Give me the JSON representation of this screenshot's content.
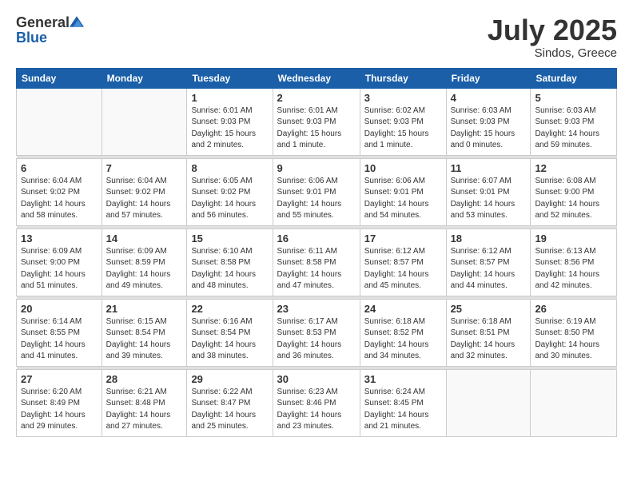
{
  "header": {
    "logo_general": "General",
    "logo_blue": "Blue",
    "title": "July 2025",
    "location": "Sindos, Greece"
  },
  "weekdays": [
    "Sunday",
    "Monday",
    "Tuesday",
    "Wednesday",
    "Thursday",
    "Friday",
    "Saturday"
  ],
  "weeks": [
    [
      {
        "day": "",
        "info": ""
      },
      {
        "day": "",
        "info": ""
      },
      {
        "day": "1",
        "info": "Sunrise: 6:01 AM\nSunset: 9:03 PM\nDaylight: 15 hours\nand 2 minutes."
      },
      {
        "day": "2",
        "info": "Sunrise: 6:01 AM\nSunset: 9:03 PM\nDaylight: 15 hours\nand 1 minute."
      },
      {
        "day": "3",
        "info": "Sunrise: 6:02 AM\nSunset: 9:03 PM\nDaylight: 15 hours\nand 1 minute."
      },
      {
        "day": "4",
        "info": "Sunrise: 6:03 AM\nSunset: 9:03 PM\nDaylight: 15 hours\nand 0 minutes."
      },
      {
        "day": "5",
        "info": "Sunrise: 6:03 AM\nSunset: 9:03 PM\nDaylight: 14 hours\nand 59 minutes."
      }
    ],
    [
      {
        "day": "6",
        "info": "Sunrise: 6:04 AM\nSunset: 9:02 PM\nDaylight: 14 hours\nand 58 minutes."
      },
      {
        "day": "7",
        "info": "Sunrise: 6:04 AM\nSunset: 9:02 PM\nDaylight: 14 hours\nand 57 minutes."
      },
      {
        "day": "8",
        "info": "Sunrise: 6:05 AM\nSunset: 9:02 PM\nDaylight: 14 hours\nand 56 minutes."
      },
      {
        "day": "9",
        "info": "Sunrise: 6:06 AM\nSunset: 9:01 PM\nDaylight: 14 hours\nand 55 minutes."
      },
      {
        "day": "10",
        "info": "Sunrise: 6:06 AM\nSunset: 9:01 PM\nDaylight: 14 hours\nand 54 minutes."
      },
      {
        "day": "11",
        "info": "Sunrise: 6:07 AM\nSunset: 9:01 PM\nDaylight: 14 hours\nand 53 minutes."
      },
      {
        "day": "12",
        "info": "Sunrise: 6:08 AM\nSunset: 9:00 PM\nDaylight: 14 hours\nand 52 minutes."
      }
    ],
    [
      {
        "day": "13",
        "info": "Sunrise: 6:09 AM\nSunset: 9:00 PM\nDaylight: 14 hours\nand 51 minutes."
      },
      {
        "day": "14",
        "info": "Sunrise: 6:09 AM\nSunset: 8:59 PM\nDaylight: 14 hours\nand 49 minutes."
      },
      {
        "day": "15",
        "info": "Sunrise: 6:10 AM\nSunset: 8:58 PM\nDaylight: 14 hours\nand 48 minutes."
      },
      {
        "day": "16",
        "info": "Sunrise: 6:11 AM\nSunset: 8:58 PM\nDaylight: 14 hours\nand 47 minutes."
      },
      {
        "day": "17",
        "info": "Sunrise: 6:12 AM\nSunset: 8:57 PM\nDaylight: 14 hours\nand 45 minutes."
      },
      {
        "day": "18",
        "info": "Sunrise: 6:12 AM\nSunset: 8:57 PM\nDaylight: 14 hours\nand 44 minutes."
      },
      {
        "day": "19",
        "info": "Sunrise: 6:13 AM\nSunset: 8:56 PM\nDaylight: 14 hours\nand 42 minutes."
      }
    ],
    [
      {
        "day": "20",
        "info": "Sunrise: 6:14 AM\nSunset: 8:55 PM\nDaylight: 14 hours\nand 41 minutes."
      },
      {
        "day": "21",
        "info": "Sunrise: 6:15 AM\nSunset: 8:54 PM\nDaylight: 14 hours\nand 39 minutes."
      },
      {
        "day": "22",
        "info": "Sunrise: 6:16 AM\nSunset: 8:54 PM\nDaylight: 14 hours\nand 38 minutes."
      },
      {
        "day": "23",
        "info": "Sunrise: 6:17 AM\nSunset: 8:53 PM\nDaylight: 14 hours\nand 36 minutes."
      },
      {
        "day": "24",
        "info": "Sunrise: 6:18 AM\nSunset: 8:52 PM\nDaylight: 14 hours\nand 34 minutes."
      },
      {
        "day": "25",
        "info": "Sunrise: 6:18 AM\nSunset: 8:51 PM\nDaylight: 14 hours\nand 32 minutes."
      },
      {
        "day": "26",
        "info": "Sunrise: 6:19 AM\nSunset: 8:50 PM\nDaylight: 14 hours\nand 30 minutes."
      }
    ],
    [
      {
        "day": "27",
        "info": "Sunrise: 6:20 AM\nSunset: 8:49 PM\nDaylight: 14 hours\nand 29 minutes."
      },
      {
        "day": "28",
        "info": "Sunrise: 6:21 AM\nSunset: 8:48 PM\nDaylight: 14 hours\nand 27 minutes."
      },
      {
        "day": "29",
        "info": "Sunrise: 6:22 AM\nSunset: 8:47 PM\nDaylight: 14 hours\nand 25 minutes."
      },
      {
        "day": "30",
        "info": "Sunrise: 6:23 AM\nSunset: 8:46 PM\nDaylight: 14 hours\nand 23 minutes."
      },
      {
        "day": "31",
        "info": "Sunrise: 6:24 AM\nSunset: 8:45 PM\nDaylight: 14 hours\nand 21 minutes."
      },
      {
        "day": "",
        "info": ""
      },
      {
        "day": "",
        "info": ""
      }
    ]
  ]
}
